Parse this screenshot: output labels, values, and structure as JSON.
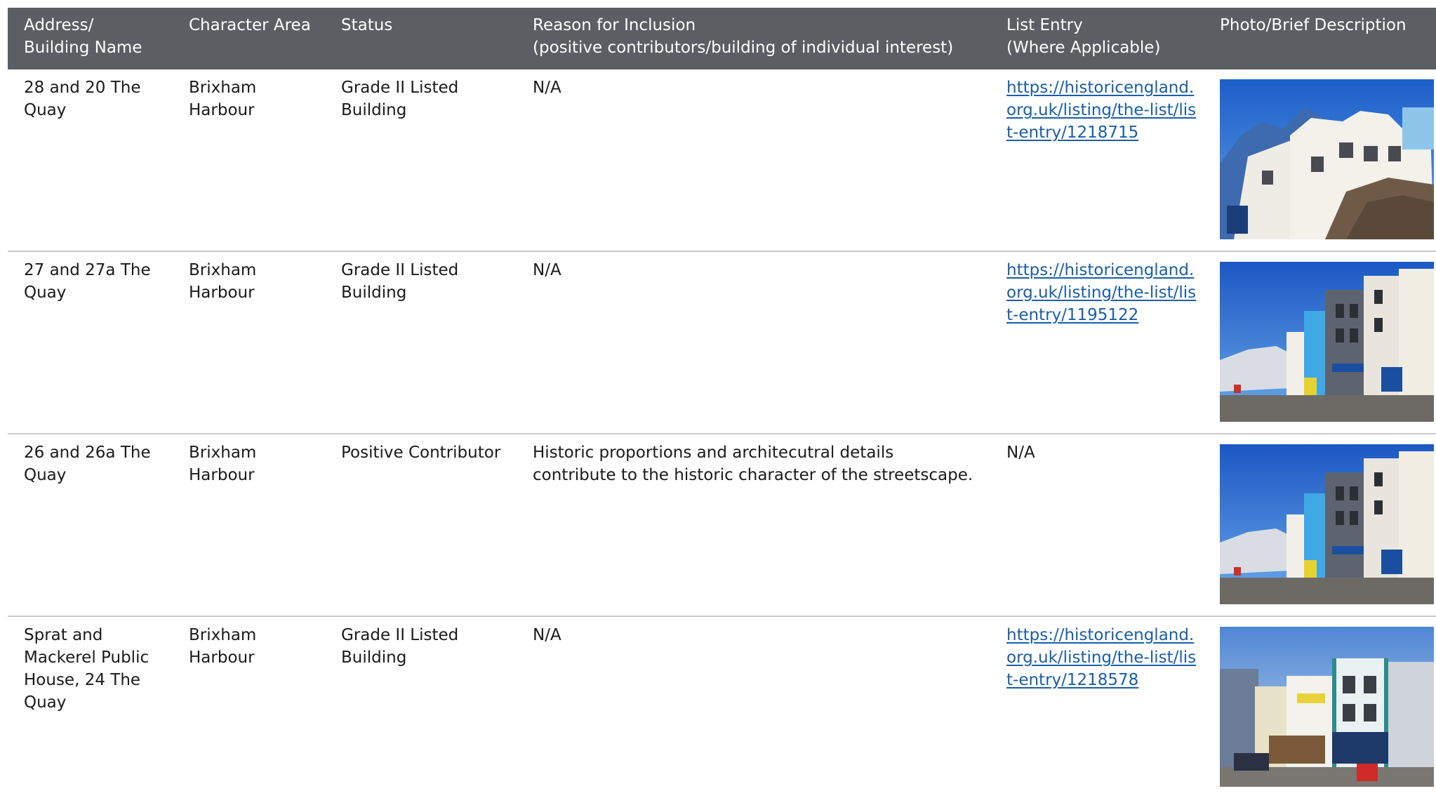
{
  "header": {
    "col_address": "Address/\nBuilding Name",
    "col_area": "Character Area",
    "col_status": "Status",
    "col_reason": "Reason for Inclusion\n(positive contributors/building of individual interest)",
    "col_list": "List Entry\n(Where Applicable)",
    "col_photo": "Photo/Brief Description"
  },
  "rows": [
    {
      "address": "28 and 20 The Quay",
      "area": "Brixham Harbour",
      "status": "Grade II Listed Building",
      "reason": "N/A",
      "list_entry": "https://historicengland.org.uk/listing/the-list/list-entry/1218715",
      "photo": "harbour-houses-cliff-photo"
    },
    {
      "address": "27 and 27a The Quay",
      "area": "Brixham Harbour",
      "status": "Grade II Listed Building",
      "reason": "N/A",
      "list_entry": "https://historicengland.org.uk/listing/the-list/list-entry/1195122",
      "photo": "quay-street-shopfronts-photo"
    },
    {
      "address": "26 and 26a The Quay",
      "area": "Brixham Harbour",
      "status": "Positive Contributor",
      "reason": "Historic proportions and architecutral details contribute to the historic character of the streetscape.",
      "list_entry": "N/A",
      "photo": "quay-street-shopfronts-photo"
    },
    {
      "address": "Sprat and Mackerel Public House, 24 The Quay",
      "area": "Brixham Harbour",
      "status": "Grade II Listed Building",
      "reason": "N/A",
      "list_entry": "https://historicengland.org.uk/listing/the-list/list-entry/1218578",
      "photo": "public-house-terrace-photo"
    }
  ],
  "colors": {
    "header_bg": "#5b5f63",
    "link": "#1a5ea8",
    "divider": "#c8c8c8"
  }
}
